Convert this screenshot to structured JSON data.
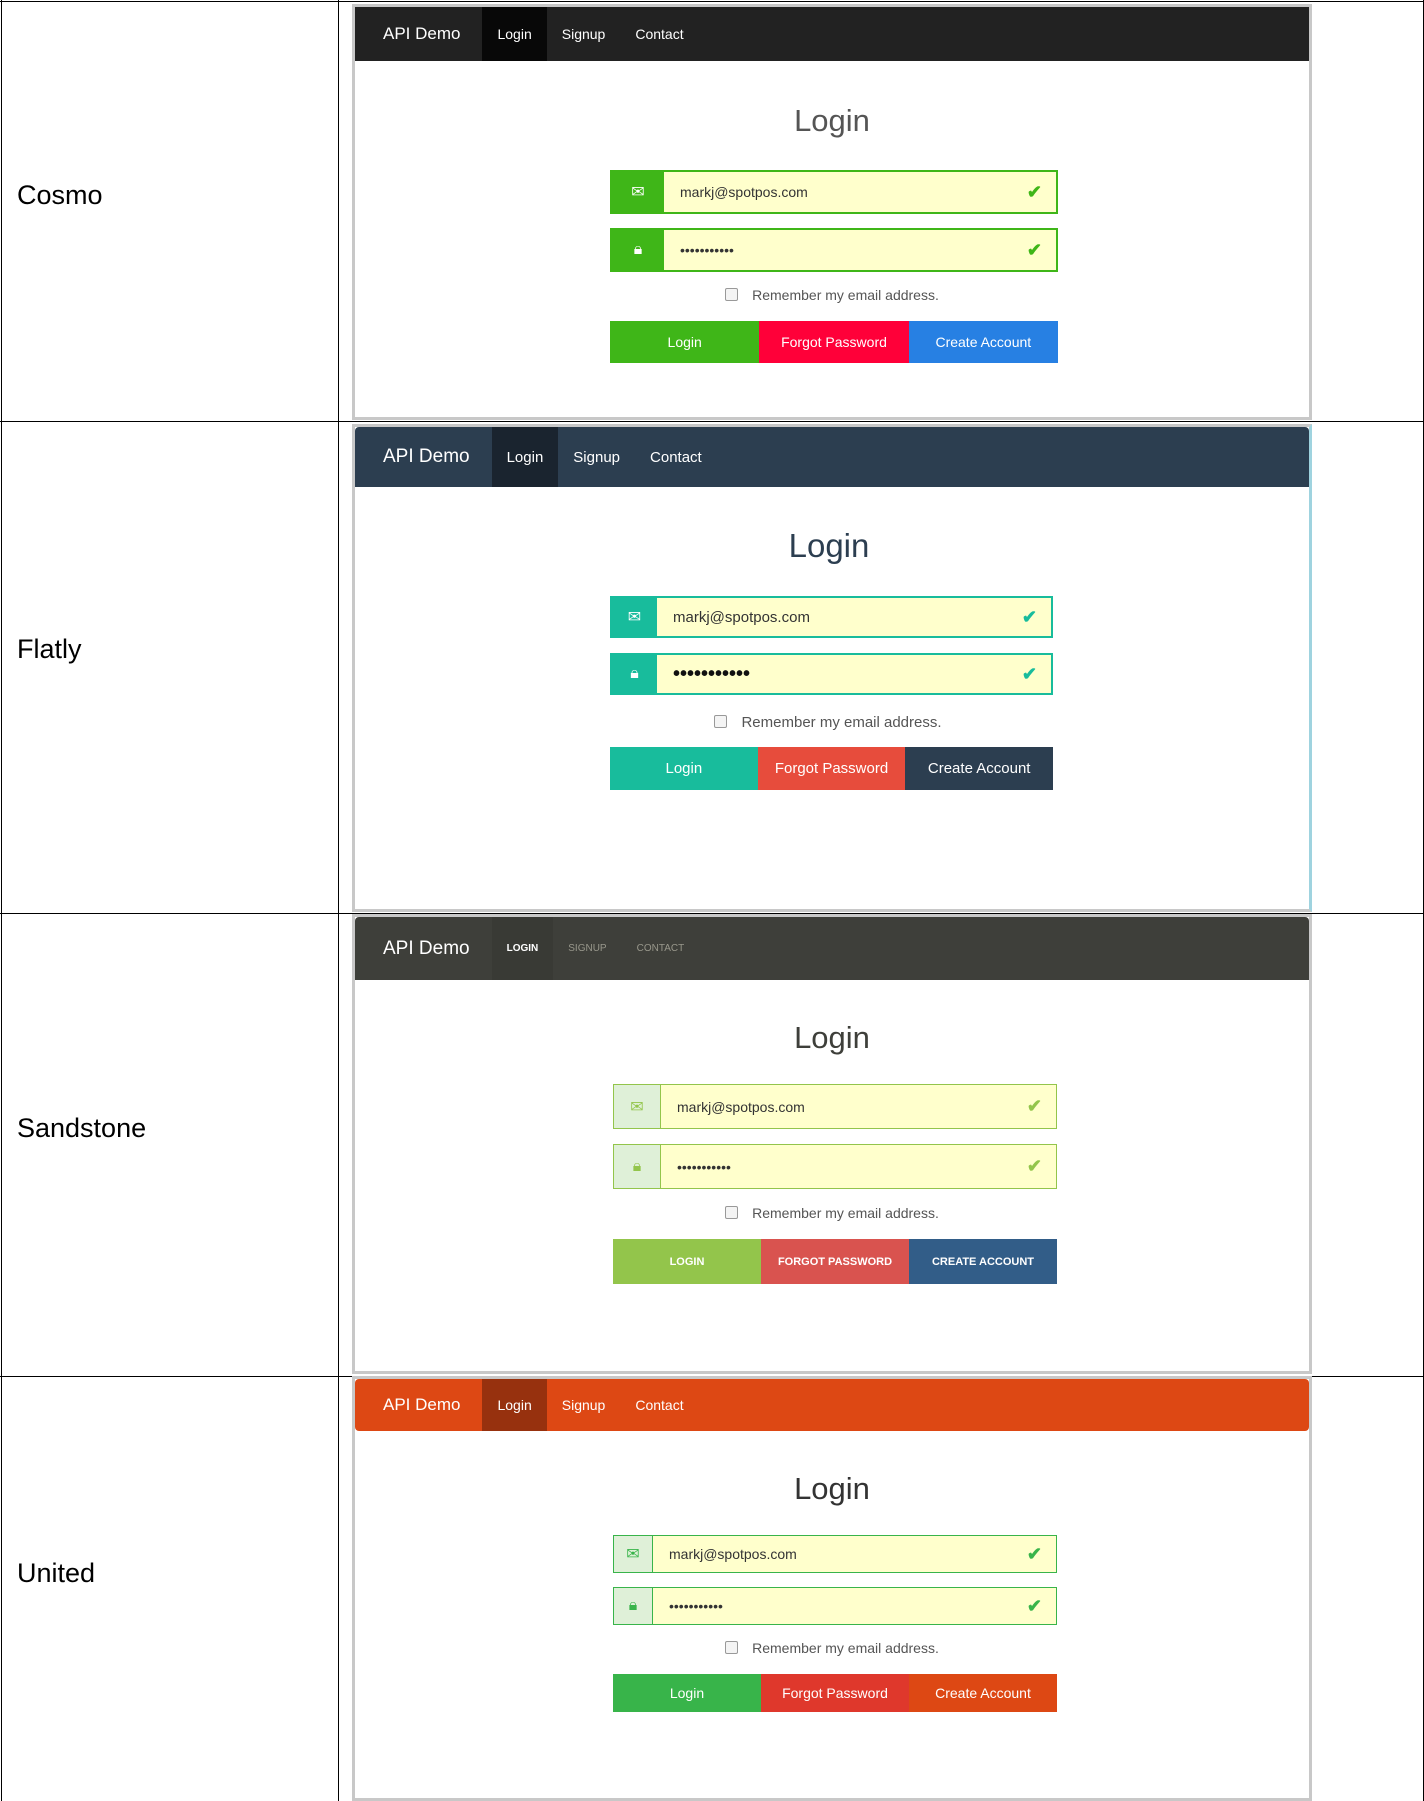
{
  "rows": [
    {
      "theme": "Cosmo",
      "nav": {
        "brand": "API Demo",
        "items": [
          "Login",
          "Signup",
          "Contact"
        ]
      },
      "title": "Login",
      "email": "markj@spotpos.com",
      "password": "•••••••••••",
      "remember": "Remember my email address.",
      "buttons": [
        "Login",
        "Forgot Password",
        "Create Account"
      ]
    },
    {
      "theme": "Flatly",
      "nav": {
        "brand": "API Demo",
        "items": [
          "Login",
          "Signup",
          "Contact"
        ]
      },
      "title": "Login",
      "email": "markj@spotpos.com",
      "password": "•••••••••••",
      "remember": "Remember my email address.",
      "buttons": [
        "Login",
        "Forgot Password",
        "Create Account"
      ]
    },
    {
      "theme": "Sandstone",
      "nav": {
        "brand": "API Demo",
        "items": [
          "LOGIN",
          "SIGNUP",
          "CONTACT"
        ]
      },
      "title": "Login",
      "email": "markj@spotpos.com",
      "password": "•••••••••••",
      "remember": "Remember my email address.",
      "buttons": [
        "LOGIN",
        "FORGOT PASSWORD",
        "CREATE ACCOUNT"
      ]
    },
    {
      "theme": "United",
      "nav": {
        "brand": "API Demo",
        "items": [
          "Login",
          "Signup",
          "Contact"
        ]
      },
      "title": "Login",
      "email": "markj@spotpos.com",
      "password": "•••••••••••",
      "remember": "Remember my email address.",
      "buttons": [
        "Login",
        "Forgot Password",
        "Create Account"
      ]
    }
  ],
  "icons": {
    "email": "envelope-icon",
    "password": "lock-icon",
    "valid": "checkmark-icon"
  },
  "colors": {
    "cosmo": {
      "nav": "#222222",
      "active": "#080808",
      "success": "#3fb618",
      "danger": "#ff0039",
      "primary": "#2780e3"
    },
    "flatly": {
      "nav": "#2c3e50",
      "active": "#1a242f",
      "success": "#18bc9c",
      "danger": "#e74c3c",
      "primary": "#2c3e50"
    },
    "sandstone": {
      "nav": "#3e3f3a",
      "active": "#393a35",
      "success": "#93c54b",
      "danger": "#d9534f",
      "primary": "#325d88"
    },
    "united": {
      "nav": "#dd4814",
      "active": "#97310e",
      "success": "#38b44a",
      "danger": "#df382c",
      "primary": "#dd4814"
    }
  }
}
